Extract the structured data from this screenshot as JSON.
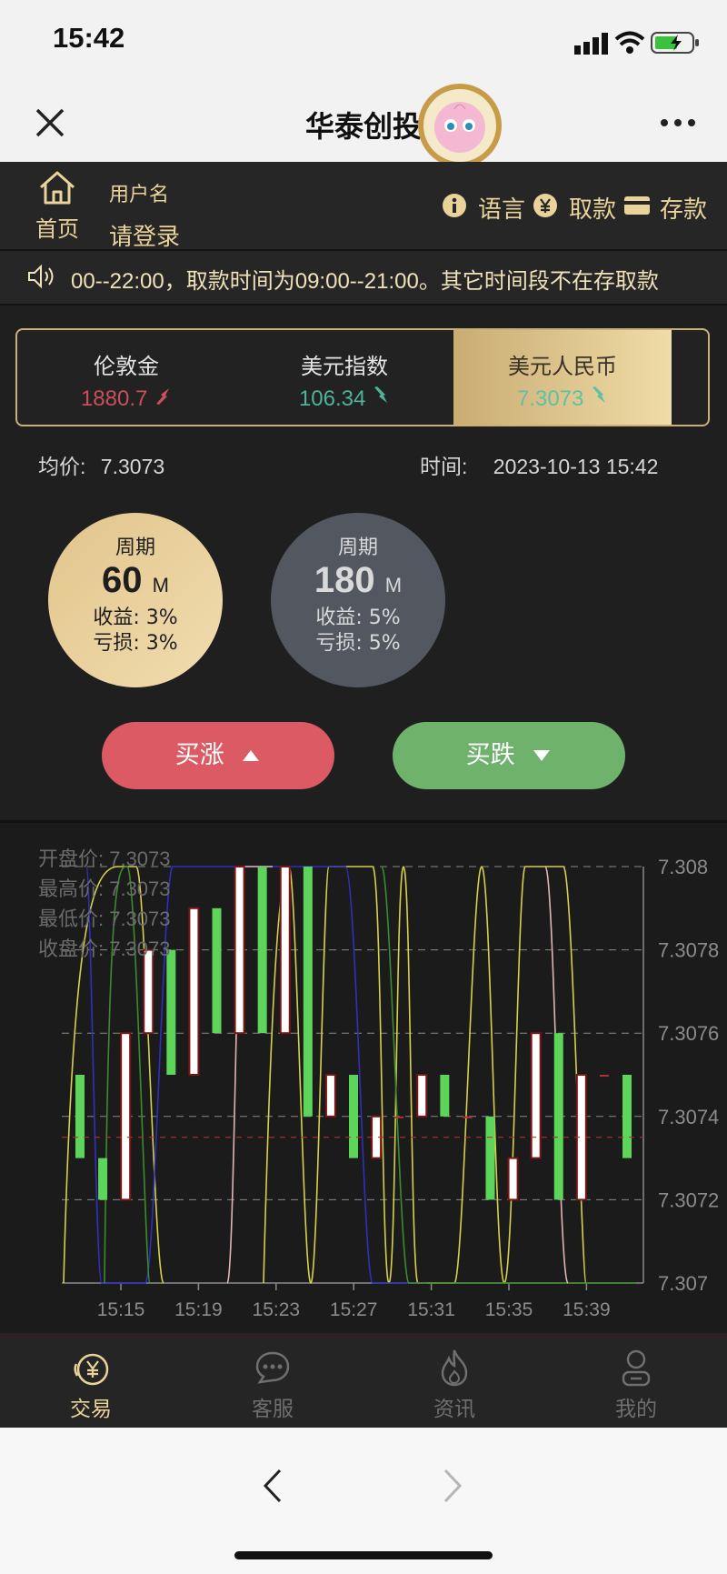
{
  "status": {
    "time": "15:42"
  },
  "titlebar": {
    "title": "华泰创投"
  },
  "header": {
    "home_label": "首页",
    "username_label": "用户名",
    "login_label": "请登录",
    "language_label": "语言",
    "withdraw_label": "取款",
    "deposit_label": "存款"
  },
  "notice": {
    "text": "00--22:00，取款时间为09:00--21:00。其它时间段不在存取款"
  },
  "tabs": [
    {
      "name": "伦敦金",
      "value": "1880.7",
      "color": "#c8505a",
      "trend": "up"
    },
    {
      "name": "美元指数",
      "value": "106.34",
      "color": "#4db39a",
      "trend": "down"
    },
    {
      "name": "美元人民币",
      "value": "7.3073",
      "color": "#5ec1a4",
      "trend": "down"
    }
  ],
  "info": {
    "avg_label": "均价:",
    "avg_value": "7.3073",
    "time_label": "时间:",
    "time_value": "2023-10-13 15:42"
  },
  "periods": [
    {
      "label": "周期",
      "value": "60",
      "unit": "M",
      "profit": "收益: 3%",
      "loss": "亏损: 3%"
    },
    {
      "label": "周期",
      "value": "180",
      "unit": "M",
      "profit": "收益: 5%",
      "loss": "亏损: 5%"
    }
  ],
  "buttons": {
    "buy_up": "买涨",
    "buy_down": "买跌"
  },
  "ohlc": {
    "open": "开盘价:  7.3073",
    "high": "最高价:  7.3073",
    "low": "最低价:  7.3073",
    "close": "收盘价:  7.3073"
  },
  "chart_data": {
    "type": "candlestick",
    "ylim": [
      7.307,
      7.308
    ],
    "y_ticks": [
      "7.308",
      "7.3078",
      "7.3076",
      "7.3074",
      "7.3072",
      "7.307"
    ],
    "x_ticks": [
      "15:15",
      "15:19",
      "15:23",
      "15:27",
      "15:31",
      "15:35",
      "15:39"
    ],
    "candles": [
      {
        "o": 7.3075,
        "c": 7.3073,
        "dir": "down"
      },
      {
        "o": 7.3073,
        "c": 7.3072,
        "dir": "down"
      },
      {
        "o": 7.3072,
        "c": 7.3076,
        "dir": "up"
      },
      {
        "o": 7.3076,
        "c": 7.3078,
        "dir": "up"
      },
      {
        "o": 7.3078,
        "c": 7.3075,
        "dir": "down"
      },
      {
        "o": 7.3075,
        "c": 7.3079,
        "dir": "up"
      },
      {
        "o": 7.3079,
        "c": 7.3076,
        "dir": "down"
      },
      {
        "o": 7.3076,
        "c": 7.308,
        "dir": "up"
      },
      {
        "o": 7.308,
        "c": 7.3076,
        "dir": "down"
      },
      {
        "o": 7.3076,
        "c": 7.308,
        "dir": "up"
      },
      {
        "o": 7.308,
        "c": 7.3074,
        "dir": "down"
      },
      {
        "o": 7.3074,
        "c": 7.3075,
        "dir": "up"
      },
      {
        "o": 7.3075,
        "c": 7.3073,
        "dir": "down"
      },
      {
        "o": 7.3073,
        "c": 7.3074,
        "dir": "up"
      },
      {
        "o": 7.3074,
        "c": 7.3074,
        "dir": "flat"
      },
      {
        "o": 7.3074,
        "c": 7.3075,
        "dir": "up"
      },
      {
        "o": 7.3075,
        "c": 7.3074,
        "dir": "down"
      },
      {
        "o": 7.3074,
        "c": 7.3074,
        "dir": "flat"
      },
      {
        "o": 7.3074,
        "c": 7.3072,
        "dir": "down"
      },
      {
        "o": 7.3072,
        "c": 7.3073,
        "dir": "up"
      },
      {
        "o": 7.3073,
        "c": 7.3076,
        "dir": "up"
      },
      {
        "o": 7.3076,
        "c": 7.3072,
        "dir": "down"
      },
      {
        "o": 7.3072,
        "c": 7.3075,
        "dir": "up"
      },
      {
        "o": 7.3075,
        "c": 7.3075,
        "dir": "flat"
      },
      {
        "o": 7.3075,
        "c": 7.3073,
        "dir": "down"
      }
    ],
    "colors": {
      "up": "#ffffff",
      "down": "#5dd45a",
      "border": "#7b1515"
    }
  },
  "tabbar": [
    {
      "label": "交易",
      "icon": "yen-circle-icon",
      "active": true
    },
    {
      "label": "客服",
      "icon": "chat-icon",
      "active": false
    },
    {
      "label": "资讯",
      "icon": "flame-icon",
      "active": false
    },
    {
      "label": "我的",
      "icon": "user-icon",
      "active": false
    }
  ]
}
